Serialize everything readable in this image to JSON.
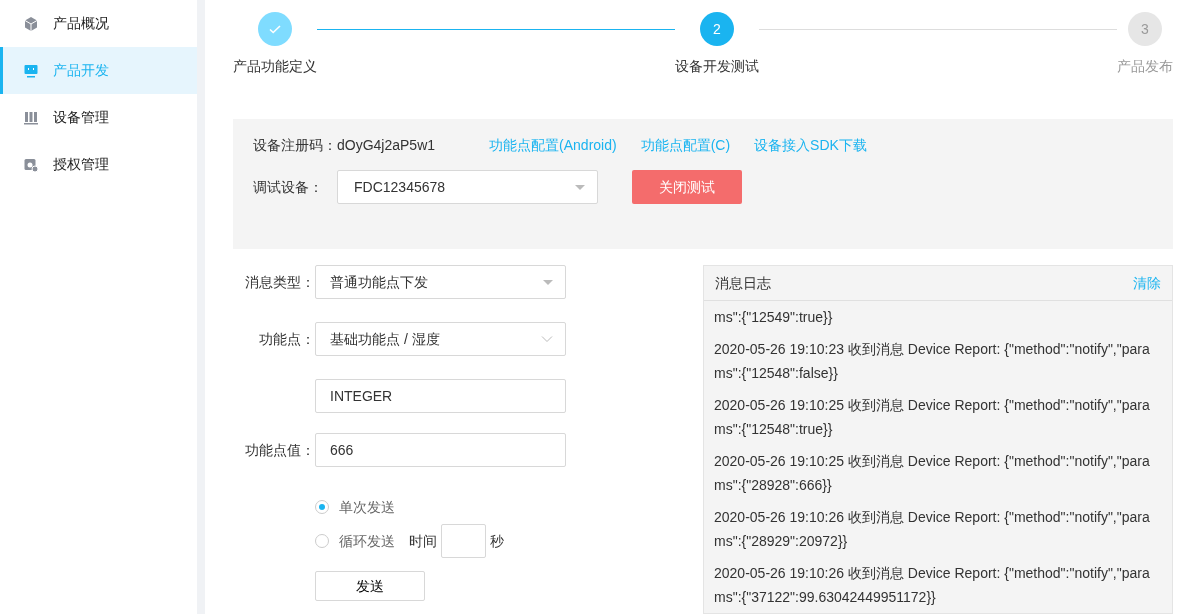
{
  "sidebar": {
    "items": [
      {
        "label": "产品概况",
        "selected": false
      },
      {
        "label": "产品开发",
        "selected": true
      },
      {
        "label": "设备管理",
        "selected": false
      },
      {
        "label": "授权管理",
        "selected": false
      }
    ]
  },
  "steps": [
    {
      "label": "产品功能定义",
      "kind": "done"
    },
    {
      "label": "设备开发测试",
      "number": "2",
      "kind": "active"
    },
    {
      "label": "产品发布",
      "number": "3",
      "kind": "pending"
    }
  ],
  "device_panel": {
    "reg_label": "设备注册码：",
    "reg_code": "dOyG4j2aP5w1",
    "links": [
      "功能点配置(Android)",
      "功能点配置(C)",
      "设备接入SDK下载"
    ],
    "debug_label": "调试设备：",
    "debug_device": "FDC12345678",
    "close_button": "关闭测试"
  },
  "form": {
    "msg_type_label": "消息类型：",
    "msg_type": "普通功能点下发",
    "point_label": "功能点：",
    "point": "基础功能点 / 湿度",
    "data_type": "INTEGER",
    "value_label": "功能点值：",
    "value": "666",
    "send_modes": [
      {
        "label": "单次发送",
        "selected": true
      },
      {
        "label": "循环发送",
        "selected": false
      }
    ],
    "interval_label": "时间",
    "interval_unit": "秒",
    "send_button": "发送"
  },
  "log": {
    "title": "消息日志",
    "clear": "清除",
    "entries": [
      "ms\":{\"12549\":true}}",
      "2020-05-26 19:10:23 收到消息 Device Report: {\"method\":\"notify\",\"params\":{\"12548\":false}}",
      "2020-05-26 19:10:25 收到消息 Device Report: {\"method\":\"notify\",\"params\":{\"12548\":true}}",
      "2020-05-26 19:10:25 收到消息 Device Report: {\"method\":\"notify\",\"params\":{\"28928\":666}}",
      "2020-05-26 19:10:26 收到消息 Device Report: {\"method\":\"notify\",\"params\":{\"28929\":20972}}",
      "2020-05-26 19:10:26 收到消息 Device Report: {\"method\":\"notify\",\"params\":{\"37122\":99.63042449951172}}"
    ]
  }
}
